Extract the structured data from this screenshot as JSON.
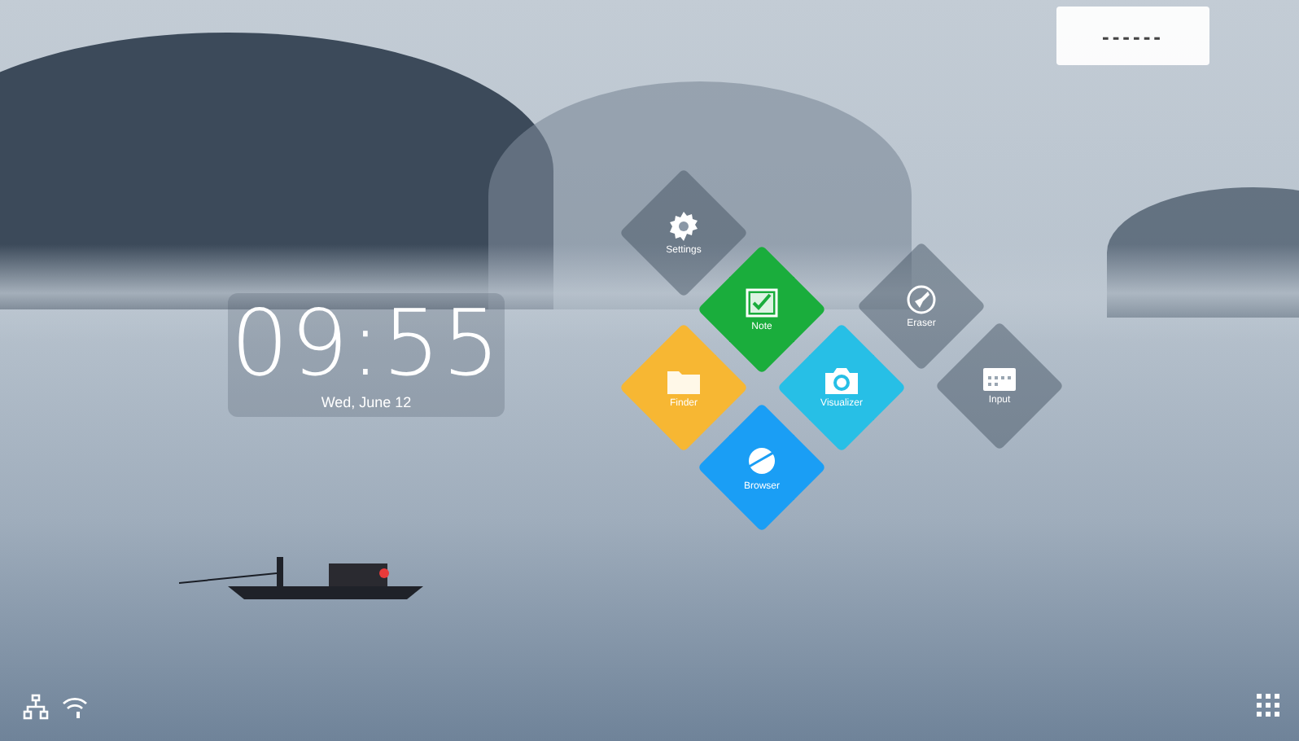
{
  "top_card": {
    "text": "------"
  },
  "clock": {
    "time": "09:55",
    "date": "Wed, June 12"
  },
  "apps": [
    {
      "label": "Settings",
      "kind": "glass"
    },
    {
      "label": "Note",
      "kind": "solid",
      "color": "#1aad3c"
    },
    {
      "label": "Eraser",
      "kind": "glass"
    },
    {
      "label": "Finder",
      "kind": "solid",
      "color": "#f7b733"
    },
    {
      "label": "Visualizer",
      "kind": "solid",
      "color": "#27bfe6"
    },
    {
      "label": "Input",
      "kind": "glass"
    },
    {
      "label": "Browser",
      "kind": "solid",
      "color": "#1a9ef5"
    }
  ]
}
